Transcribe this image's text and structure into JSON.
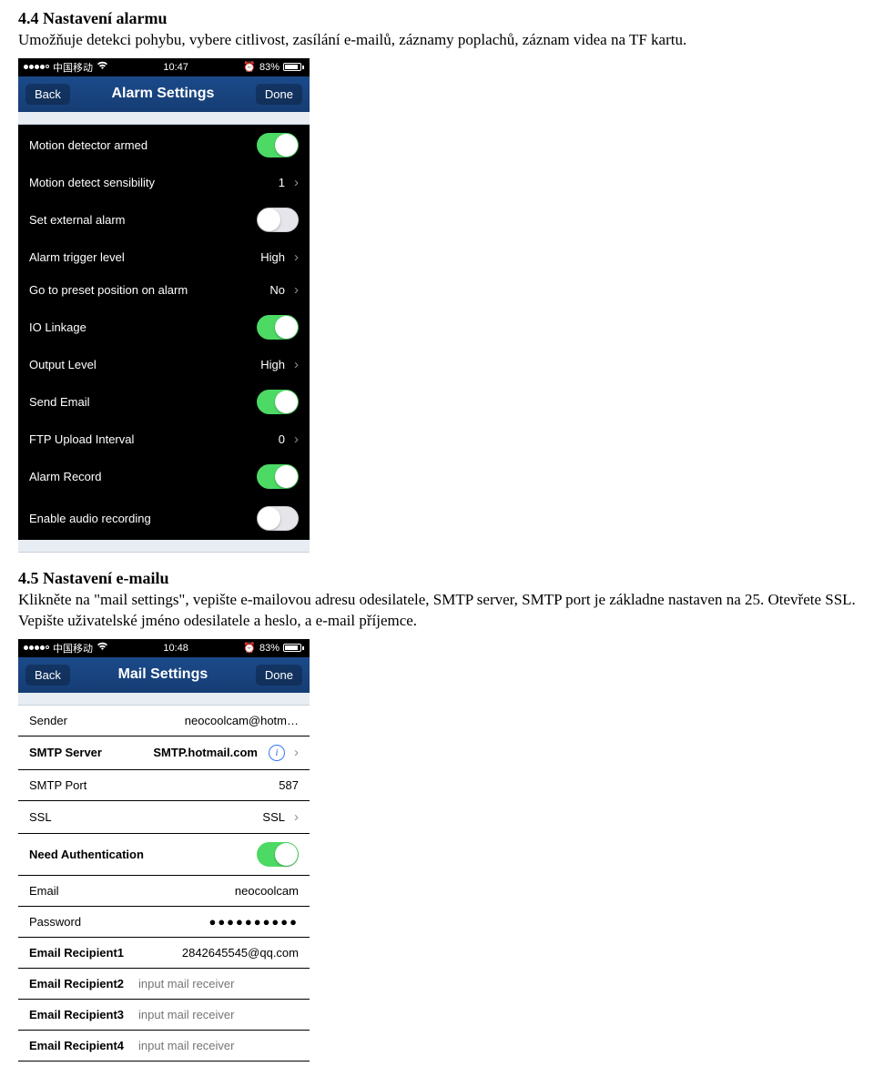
{
  "section1": {
    "heading": "4.4 Nastavení alarmu",
    "body": "Umožňuje detekci pohybu, vybere citlivost, zasílání e-mailů, záznamy poplachů, záznam videa na TF kartu."
  },
  "section2": {
    "heading": "4.5 Nastavení e-mailu",
    "body": "Klikněte na \"mail settings\", vepište e-mailovou adresu odesilatele, SMTP server, SMTP port je základne nastaven na 25. Otevřete SSL. Vepište uživatelské jméno odesilatele a heslo, a e-mail příjemce."
  },
  "phone1": {
    "status": {
      "carrier": "中国移动",
      "time": "10:47",
      "battery": "83%",
      "alarm": "⏰"
    },
    "nav": {
      "back": "Back",
      "title": "Alarm Settings",
      "done": "Done"
    },
    "rows": {
      "motion_armed": "Motion detector armed",
      "motion_sens": "Motion detect sensibility",
      "motion_sens_val": "1",
      "ext_alarm": "Set external alarm",
      "trigger": "Alarm trigger level",
      "trigger_val": "High",
      "preset": "Go to preset position on alarm",
      "preset_val": "No",
      "io": "IO Linkage",
      "output": "Output Level",
      "output_val": "High",
      "email": "Send Email",
      "ftp": "FTP Upload Interval",
      "ftp_val": "0",
      "record": "Alarm Record",
      "audio": "Enable audio recording"
    }
  },
  "phone2": {
    "status": {
      "carrier": "中国移动",
      "time": "10:48",
      "battery": "83%",
      "alarm": "⏰"
    },
    "nav": {
      "back": "Back",
      "title": "Mail Settings",
      "done": "Done"
    },
    "rows": {
      "sender": "Sender",
      "sender_val": "neocoolcam@hotm…",
      "smtp": "SMTP Server",
      "smtp_val": "SMTP.hotmail.com",
      "port": "SMTP Port",
      "port_val": "587",
      "ssl": "SSL",
      "ssl_val": "SSL",
      "auth": "Need Authentication",
      "email": "Email",
      "email_val": "neocoolcam",
      "pwd": "Password",
      "pwd_val": "●●●●●●●●●●",
      "r1": "Email Recipient1",
      "r1_val": "2842645545@qq.com",
      "r2": "Email Recipient2",
      "r3": "Email Recipient3",
      "r4": "Email Recipient4",
      "placeholder": "input mail receiver"
    }
  }
}
